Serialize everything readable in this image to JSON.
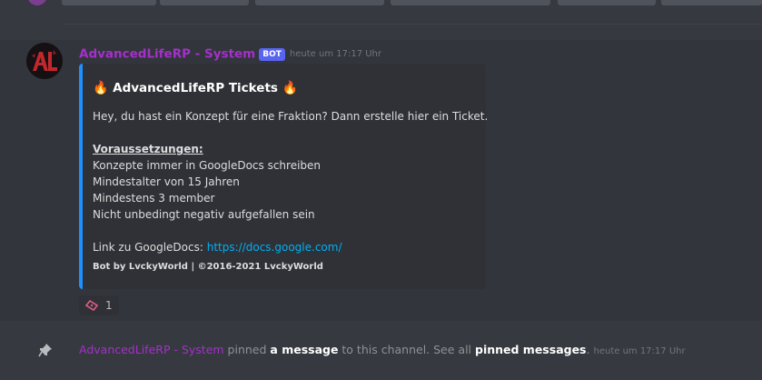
{
  "colors": {
    "background": "#36393f",
    "hover": "#32353b",
    "embed_background": "#2f3136",
    "embed_accent": "#1e90ff",
    "username": "#a530ca",
    "bot_tag": "#5865f2",
    "link": "#00aff4",
    "timestamp": "#72767d"
  },
  "message": {
    "username": "AdvancedLifeRP - System",
    "bot_tag": "BOT",
    "timestamp": "heute um 17:17 Uhr",
    "avatar_icon": "server-logo-icon",
    "embed": {
      "title_icon_left": "fire-emoji",
      "title": "AdvancedLifeRP Tickets",
      "title_icon_right": "fire-emoji",
      "intro": "Hey, du hast ein Konzept für eine Fraktion? Dann erstelle hier ein Ticket.",
      "requirements_heading": "Voraussetzungen:",
      "requirements": [
        "Konzepte immer in GoogleDocs schreiben",
        "Mindestalter von 15 Jahren",
        "Mindestens 3 member",
        "Nicht unbedingt negativ aufgefallen sein"
      ],
      "link_label": "Link zu GoogleDocs:",
      "link_url": "https://docs.google.com/",
      "footer": "Bot by LvckyWorld | ©2016-2021 LvckyWorld"
    },
    "reaction": {
      "icon": "ticket-emoji",
      "count": "1"
    }
  },
  "system_message": {
    "icon": "pin-icon",
    "username": "AdvancedLifeRP - System",
    "text_pinned": " pinned ",
    "link_message": "a message",
    "text_channel": " to this channel. See all ",
    "link_pinned": "pinned messages",
    "text_end": ".",
    "timestamp": "heute um 17:17 Uhr"
  }
}
